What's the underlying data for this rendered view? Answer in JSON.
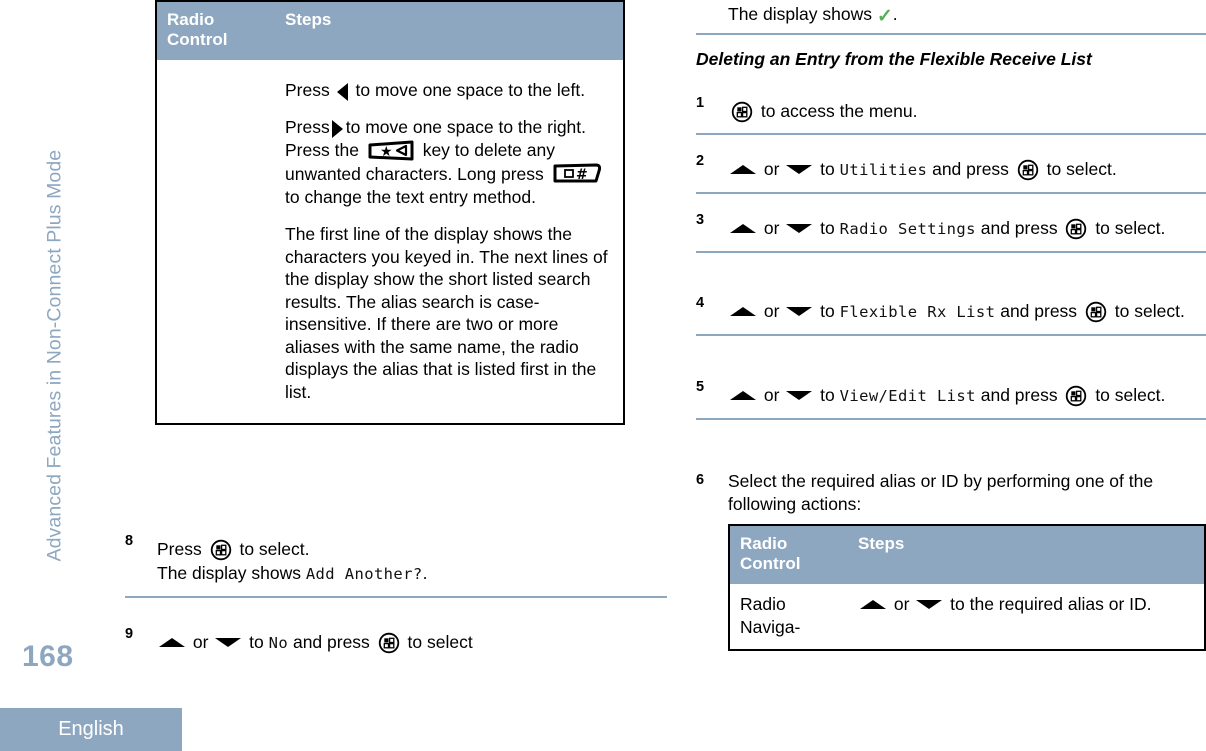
{
  "sidebar": {
    "chapter_label": "Advanced Features in Non-Connect Plus Mode",
    "page_number": "168",
    "language": "English"
  },
  "left_column": {
    "table": {
      "headers": [
        "Radio Control",
        "Steps"
      ],
      "header_control": "Radio Control",
      "header_steps": "Steps",
      "rows": [
        {
          "control": "",
          "steps_paragraphs": [
            {
              "id": "p1",
              "segments": [
                {
                  "type": "text",
                  "value": "Press "
                },
                {
                  "type": "icon",
                  "value": "arrow-left-icon"
                },
                {
                  "type": "text",
                  "value": " to move one space to the left."
                }
              ],
              "plain": "Press ◀ to move one space to the left."
            },
            {
              "id": "p2",
              "segments": [
                {
                  "type": "text",
                  "value": "Press "
                },
                {
                  "type": "icon",
                  "value": "arrow-right-icon"
                },
                {
                  "type": "text",
                  "value": " to move one space to the right. Press the "
                },
                {
                  "type": "icon",
                  "value": "star-backspace-key-icon"
                },
                {
                  "type": "text",
                  "value": " key to delete any unwanted characters. Long press "
                },
                {
                  "type": "icon",
                  "value": "hash-shift-key-icon"
                },
                {
                  "type": "text",
                  "value": " to change the text entry method."
                }
              ],
              "text_a": "Press ",
              "text_b": " to move one space to the ",
              "text_c": "right. Press the ",
              "text_d": " key to delete any unwanted characters. Long press ",
              "text_e": " to change the text entry method."
            },
            {
              "id": "p3",
              "plain": "The first line of the display shows the characters you keyed in. The next lines of the display show the short listed search results. The alias search is case-insensitive. If there are two or more aliases with the same name, the radio displays the alias that is listed first in the list."
            }
          ]
        }
      ]
    },
    "steps": [
      {
        "number": "8",
        "line1_before": "Press ",
        "line1_icon": "menu-button-icon",
        "line1_after": " to select.",
        "line2_before": "The display shows ",
        "line2_display": "Add Another?",
        "line2_after": "."
      },
      {
        "number": "9",
        "icon_up": "arrow-up-icon",
        "text_or": " or ",
        "icon_down": "arrow-down-icon",
        "text_to": " to ",
        "display": "No",
        "text_and_press": " and press ",
        "icon_menu": "menu-button-icon",
        "text_end": " to select"
      }
    ]
  },
  "right_column": {
    "top_line": {
      "before": "The display shows ",
      "icon": "green-check-icon",
      "after": "."
    },
    "heading": "Deleting an Entry from the Flexible Receive List",
    "steps": [
      {
        "number": "1",
        "icon_menu": "menu-button-icon",
        "text_end": " to access the menu."
      },
      {
        "number": "2",
        "icon_up": "arrow-up-icon",
        "text_or": " or ",
        "icon_down": "arrow-down-icon",
        "text_to": " to ",
        "display": "Utilities",
        "text_and_press": " and press ",
        "icon_menu": "menu-button-icon",
        "text_end": " to select."
      },
      {
        "number": "3",
        "icon_up": "arrow-up-icon",
        "text_or": " or ",
        "icon_down": "arrow-down-icon",
        "text_to": " to ",
        "display": "Radio Settings",
        "text_and_press": " and press ",
        "icon_menu": "menu-button-icon",
        "text_end": " to select."
      },
      {
        "number": "4",
        "icon_up": "arrow-up-icon",
        "text_or": " or ",
        "icon_down": "arrow-down-icon",
        "text_to": " to ",
        "display": "Flexible Rx List",
        "text_and_press": " and press ",
        "icon_menu": "menu-button-icon",
        "text_end": " to select."
      },
      {
        "number": "5",
        "icon_up": "arrow-up-icon",
        "text_or": " or ",
        "icon_down": "arrow-down-icon",
        "text_to": " to ",
        "display": "View/Edit List",
        "text_and_press": " and press ",
        "icon_menu": "menu-button-icon",
        "text_end": " to select."
      },
      {
        "number": "6",
        "text": "Select the required alias or ID by performing one of the following actions:"
      }
    ],
    "table": {
      "header_control": "Radio Control",
      "header_steps": "Steps",
      "row": {
        "control": "Radio Naviga-",
        "steps_before": "",
        "icon_up": "arrow-up-icon",
        "text_or": " or ",
        "icon_down": "arrow-down-icon",
        "steps_after": " to the required alias or ID."
      }
    }
  },
  "colors": {
    "accent_blue_gray": "#8ea7c0",
    "table_border": "#000000",
    "check_green": "#54b054",
    "text": "#000000"
  }
}
